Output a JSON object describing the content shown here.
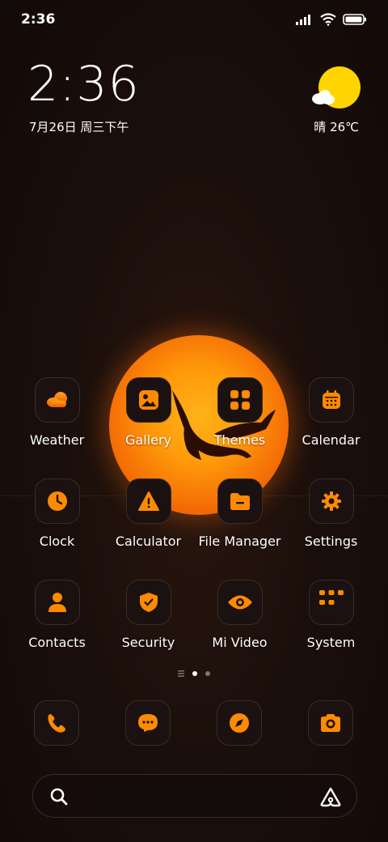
{
  "status_bar": {
    "time": "2:36",
    "icons": [
      "signal-icon",
      "wifi-icon",
      "battery-icon"
    ]
  },
  "clock_widget": {
    "time": "2:36",
    "date": "7月26日 周三下午"
  },
  "weather_widget": {
    "condition_icon": "sun-cloud-icon",
    "text": "晴 26℃"
  },
  "colors": {
    "accent": "#ff8a00",
    "accent_dark": "#e05a00",
    "icon_bg": "#1a1110",
    "icon_border": "#3a2d28"
  },
  "apps": [
    {
      "label": "Weather",
      "icon": "weather-cloud-icon"
    },
    {
      "label": "Gallery",
      "icon": "gallery-icon"
    },
    {
      "label": "Themes",
      "icon": "themes-icon"
    },
    {
      "label": "Calendar",
      "icon": "calendar-icon"
    },
    {
      "label": "Clock",
      "icon": "clock-icon"
    },
    {
      "label": "Calculator",
      "icon": "calculator-icon"
    },
    {
      "label": "File Manager",
      "icon": "folder-icon"
    },
    {
      "label": "Settings",
      "icon": "gear-icon"
    },
    {
      "label": "Contacts",
      "icon": "contacts-icon"
    },
    {
      "label": "Security",
      "icon": "shield-icon"
    },
    {
      "label": "Mi Video",
      "icon": "video-eye-icon"
    },
    {
      "label": "System",
      "icon": "folder-grid-icon"
    }
  ],
  "page_indicator": {
    "pages": 2,
    "active": 1
  },
  "dock": [
    {
      "icon": "phone-icon"
    },
    {
      "icon": "messages-icon"
    },
    {
      "icon": "browser-compass-icon"
    },
    {
      "icon": "camera-icon"
    }
  ],
  "search_bar": {
    "left_icon": "search-icon",
    "right_icon": "assistant-icon"
  }
}
